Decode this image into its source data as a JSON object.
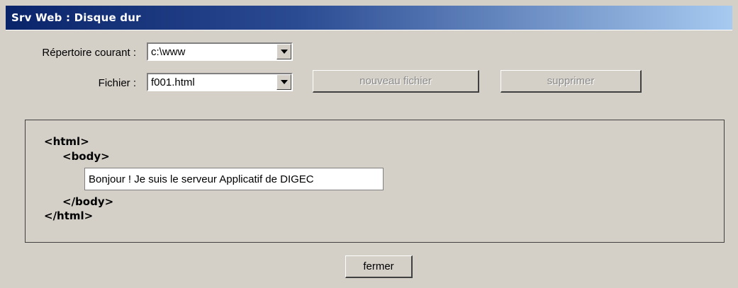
{
  "window": {
    "title": "Srv Web : Disque dur"
  },
  "form": {
    "directory_label": "Répertoire courant :",
    "directory_value": "c:\\www",
    "file_label": "Fichier :",
    "file_value": "f001.html"
  },
  "buttons": {
    "new_file": "nouveau fichier",
    "delete": "supprimer",
    "close": "fermer"
  },
  "preview": {
    "html_open": "<html>",
    "body_open": "<body>",
    "text_value": "Bonjour ! Je suis le serveur Applicatif de DIGEC",
    "body_close": "</body>",
    "html_close": "</html>"
  },
  "icons": {
    "dropdown": "chevron-down-icon"
  }
}
